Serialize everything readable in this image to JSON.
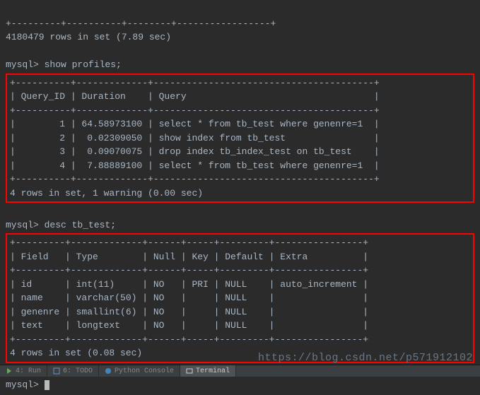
{
  "terminal": {
    "top_separator": "+---------+----------+--------+-----------------+",
    "rows_summary_top": "4180479 rows in set (7.89 sec)",
    "prompt1": "mysql> ",
    "cmd1": "show profiles;",
    "profiles_border": "+----------+-------------+----------------------------------------+",
    "profiles_header": "| Query_ID | Duration    | Query                                  |",
    "profiles_rows": [
      "|        1 | 64.58973100 | select * from tb_test where genenre=1  |",
      "|        2 |  0.02309050 | show index from tb_test                |",
      "|        3 |  0.09070075 | drop index tb_index_test on tb_test    |",
      "|        4 |  7.88889100 | select * from tb_test where genenre=1  |"
    ],
    "profiles_summary": "4 rows in set, 1 warning (0.00 sec)",
    "prompt2": "mysql> ",
    "cmd2": "desc tb_test;",
    "desc_border": "+---------+-------------+------+-----+---------+----------------+",
    "desc_header": "| Field   | Type        | Null | Key | Default | Extra          |",
    "desc_rows": [
      "| id      | int(11)     | NO   | PRI | NULL    | auto_increment |",
      "| name    | varchar(50) | NO   |     | NULL    |                |",
      "| genenre | smallint(6) | NO   |     | NULL    |                |",
      "| text    | longtext    | NO   |     | NULL    |                |"
    ],
    "desc_summary": "4 rows in set (0.08 sec)",
    "prompt3": "mysql> "
  },
  "watermark": "https://blog.csdn.net/p571912102",
  "bottom": {
    "tab1": "4: Run",
    "tab2": "6: TODO",
    "tab3": "Python Console",
    "tab4": "Terminal"
  }
}
